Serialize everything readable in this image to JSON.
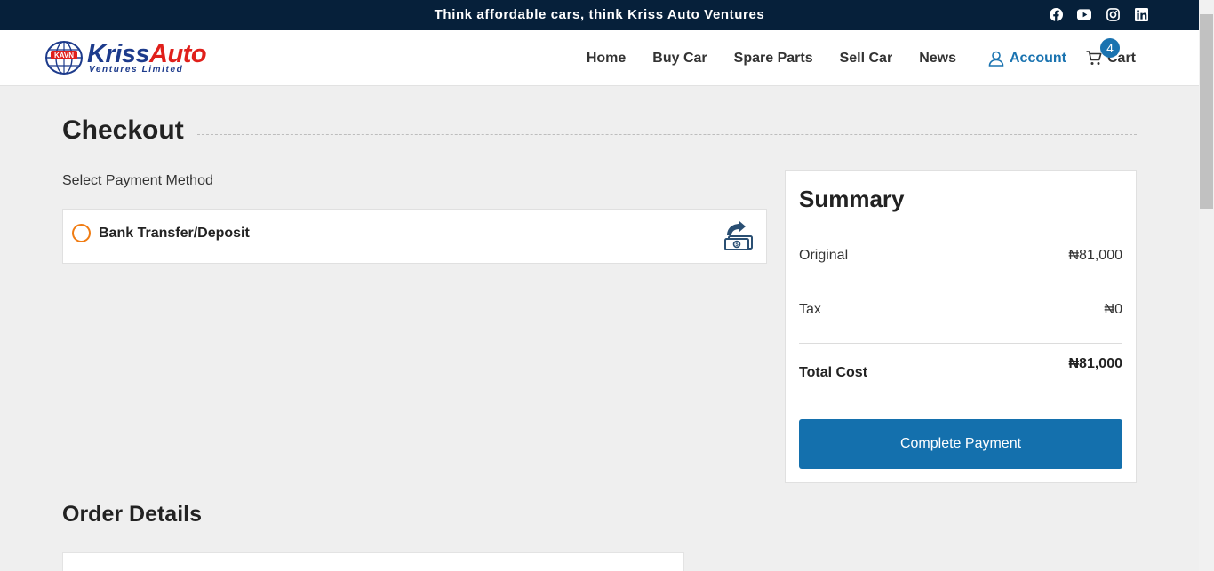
{
  "topbar": {
    "tagline": "Think affordable cars, think Kriss Auto Ventures",
    "socials": [
      {
        "icon": "facebook-icon"
      },
      {
        "icon": "youtube-icon"
      },
      {
        "icon": "instagram-icon"
      },
      {
        "icon": "linkedin-icon"
      }
    ]
  },
  "header": {
    "logo": {
      "main_a": "Kriss",
      "main_b": "Auto",
      "sub": "Ventures Limited",
      "emblem_text": "KAVN"
    },
    "nav": {
      "home": "Home",
      "buy_car": "Buy Car",
      "spare_parts": "Spare Parts",
      "sell_car": "Sell Car",
      "news": "News",
      "account": "Account",
      "cart": "Cart",
      "cart_count": "4"
    }
  },
  "checkout": {
    "title": "Checkout",
    "payment_label": "Select Payment Method",
    "payment_option": "Bank Transfer/Deposit"
  },
  "summary": {
    "title": "Summary",
    "original_label": "Original",
    "original_value": "₦81,000",
    "tax_label": "Tax",
    "tax_value": "₦0",
    "total_label": "Total Cost",
    "total_value": "₦81,000",
    "button": "Complete Payment"
  },
  "order": {
    "title": "Order Details"
  },
  "colors": {
    "topbar": "#06203a",
    "accent": "#1a73b0",
    "button": "#1470ad",
    "radio": "#f07c13",
    "logo_blue": "#1d3b8c",
    "logo_red": "#e0201b"
  }
}
